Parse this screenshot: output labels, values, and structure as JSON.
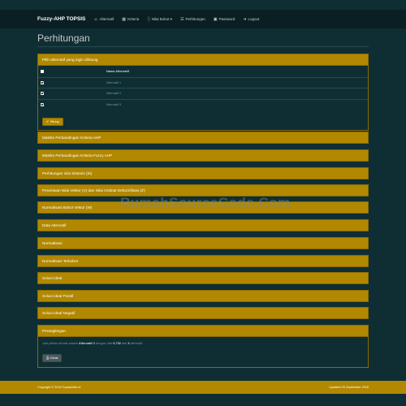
{
  "navbar": {
    "brand": "Fuzzy-AHP TOPSIS",
    "items": [
      {
        "label": "Alternatif",
        "icon": "user-icon"
      },
      {
        "label": "Kriteria",
        "icon": "grid-icon"
      },
      {
        "label": "Nilai Bobot ▾",
        "icon": "bar-chart-icon"
      },
      {
        "label": "Perhitungan",
        "icon": "list-icon"
      },
      {
        "label": "Password",
        "icon": "lock-icon"
      },
      {
        "label": "Logout",
        "icon": "logout-icon"
      }
    ]
  },
  "page_title": "Perhitungan",
  "select_panel": {
    "heading": "Pilih alternatif yang ingin dihitung",
    "column_header": "Nama Alternatif",
    "rows": [
      {
        "name": "Alternatif 1",
        "checked": true
      },
      {
        "name": "Alternatif 2",
        "checked": true
      },
      {
        "name": "Alternatif 3",
        "checked": true
      }
    ],
    "button_label": "Hitung"
  },
  "sections": [
    "Matriks Perbandingan Kriteria AHP",
    "Matriks Perbandingan Kriteria Fuzzy AHP",
    "Perhitungan nilai Sintesis (Si)",
    "Penentuan Nilai Vektor (V) dan Nilai Ordinat Defuzzifikasi (d')",
    "Normalisasi Bobot Vektor (W)",
    "Data Alternatif",
    "Normalisasi",
    "Normalisasi Terbobot",
    "Solusi Ideal",
    "Solusi Ideal Positif",
    "Solusi Ideal Negatif"
  ],
  "ranking_panel": {
    "heading": "Perangkingan",
    "text_prefix": "Jadi pilihan terbaik adalah",
    "best": "Alternatif 2",
    "text_mid": "dengan nilai",
    "value": "0.732",
    "text_of": "dari",
    "count": "3",
    "text_suffix": "alternatif.",
    "print_label": "Cetak"
  },
  "watermark": "RumahSourceCode.Com",
  "footer": {
    "left": "Copyright © 2018 TopsisAhbr.Id",
    "right": "Updated 26 September 2018"
  },
  "colors": {
    "background": "#0f2e33",
    "accent": "#b18800",
    "navbar": "#0a1f24"
  }
}
